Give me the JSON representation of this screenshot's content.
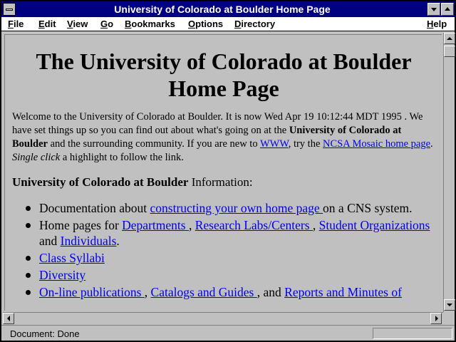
{
  "window": {
    "title": "University of Colorado at Boulder Home Page"
  },
  "menu": {
    "file": {
      "u": "F",
      "rest": "ile"
    },
    "edit": {
      "u": "E",
      "rest": "dit"
    },
    "view": {
      "u": "V",
      "rest": "iew"
    },
    "go": {
      "u": "G",
      "rest": "o"
    },
    "bookmarks": {
      "u": "B",
      "rest": "ookmarks"
    },
    "options": {
      "u": "O",
      "rest": "ptions"
    },
    "directory": {
      "u": "D",
      "rest": "irectory"
    },
    "help": {
      "u": "H",
      "rest": "elp"
    }
  },
  "page": {
    "heading": "The University of Colorado at Boulder Home Page",
    "intro": {
      "t1": "Welcome to the University of Colorado at Boulder. It is now Wed Apr 19 10:12:44 MDT 1995 . We have set things up so you can find out about what's going on at the ",
      "b1": "University of Colorado at Boulder",
      "t2": " and the surrounding community. If you are new to ",
      "link_www": "WWW",
      "t3": ", try the ",
      "link_mosaic": "NCSA Mosaic home page",
      "t4": ". ",
      "i1": "Single click",
      "t5": " a highlight to follow the link."
    },
    "section": {
      "bold": "University of Colorado at Boulder",
      "rest": " Information:"
    },
    "items": {
      "doc": {
        "pre": "Documentation about ",
        "link": "constructing your own home page ",
        "post": "on a CNS system."
      },
      "home": {
        "pre": "Home pages for ",
        "link1": "Departments ",
        "sep1": ", ",
        "link2": "Research Labs/Centers ",
        "sep2": ", ",
        "link3": "Student Organizations ",
        "sep3": "and ",
        "link4": "Individuals",
        "post": "."
      },
      "syllabi": {
        "link": "Class Syllabi "
      },
      "diversity": {
        "link": "Diversity "
      },
      "pubs": {
        "link1": "On-line publications ",
        "sep1": ", ",
        "link2": "Catalogs and Guides ",
        "sep2": ", and ",
        "link3": "Reports and Minutes of"
      }
    }
  },
  "status": {
    "text": "Document: Done"
  },
  "colors": {
    "titlebar": "#000080",
    "link": "#0000ee",
    "background": "#c0c0c0"
  }
}
